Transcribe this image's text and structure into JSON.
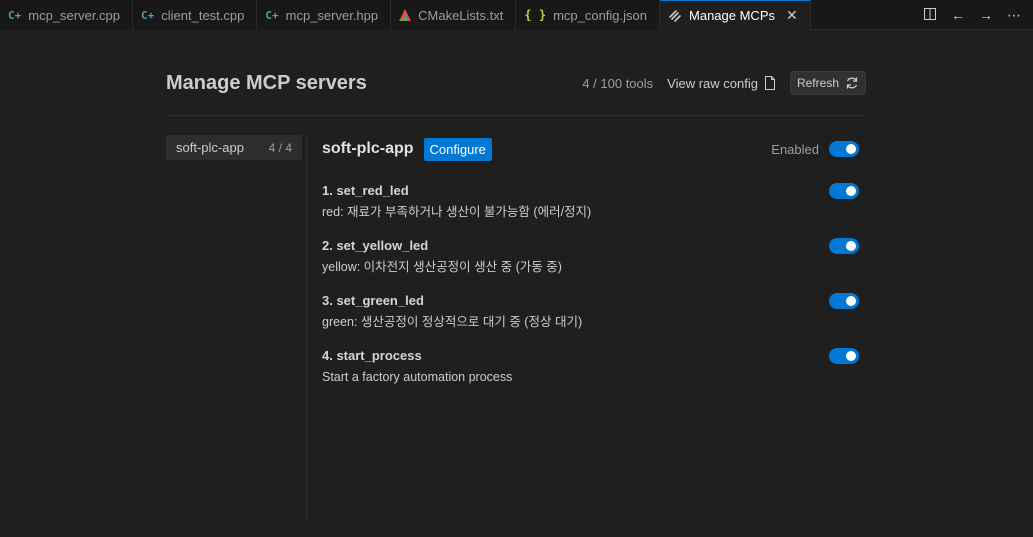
{
  "tabs": [
    {
      "label": "mcp_server.cpp",
      "icon": "cpp-icon",
      "active": false
    },
    {
      "label": "client_test.cpp",
      "icon": "cpp-icon",
      "active": false
    },
    {
      "label": "mcp_server.hpp",
      "icon": "cpp-icon",
      "active": false
    },
    {
      "label": "CMakeLists.txt",
      "icon": "cmake-icon",
      "active": false
    },
    {
      "label": "mcp_config.json",
      "icon": "json-icon",
      "active": false
    },
    {
      "label": "Manage MCPs",
      "icon": "mcp-icon",
      "active": true
    }
  ],
  "header": {
    "title": "Manage MCP servers",
    "tools_count": "4 / 100 tools",
    "view_raw_config": "View raw config",
    "refresh": "Refresh"
  },
  "sidebar": {
    "servers": [
      {
        "name": "soft-plc-app",
        "count": "4 / 4"
      }
    ]
  },
  "detail": {
    "server_name": "soft-plc-app",
    "configure": "Configure",
    "enabled_label": "Enabled",
    "tools": [
      {
        "name": "1. set_red_led",
        "desc": "red: 재료가 부족하거나 생산이 불가능함 (에러/정지)",
        "enabled": true
      },
      {
        "name": "2. set_yellow_led",
        "desc": "yellow: 이차전지 생산공정이 생산 중 (가동 중)",
        "enabled": true
      },
      {
        "name": "3. set_green_led",
        "desc": "green: 생산공정이 정상적으로 대기 중 (정상 대기)",
        "enabled": true
      },
      {
        "name": "4. start_process",
        "desc": "Start a factory automation process",
        "enabled": true
      }
    ]
  },
  "colors": {
    "accent": "#0078d4",
    "background": "#1f1f1f"
  }
}
